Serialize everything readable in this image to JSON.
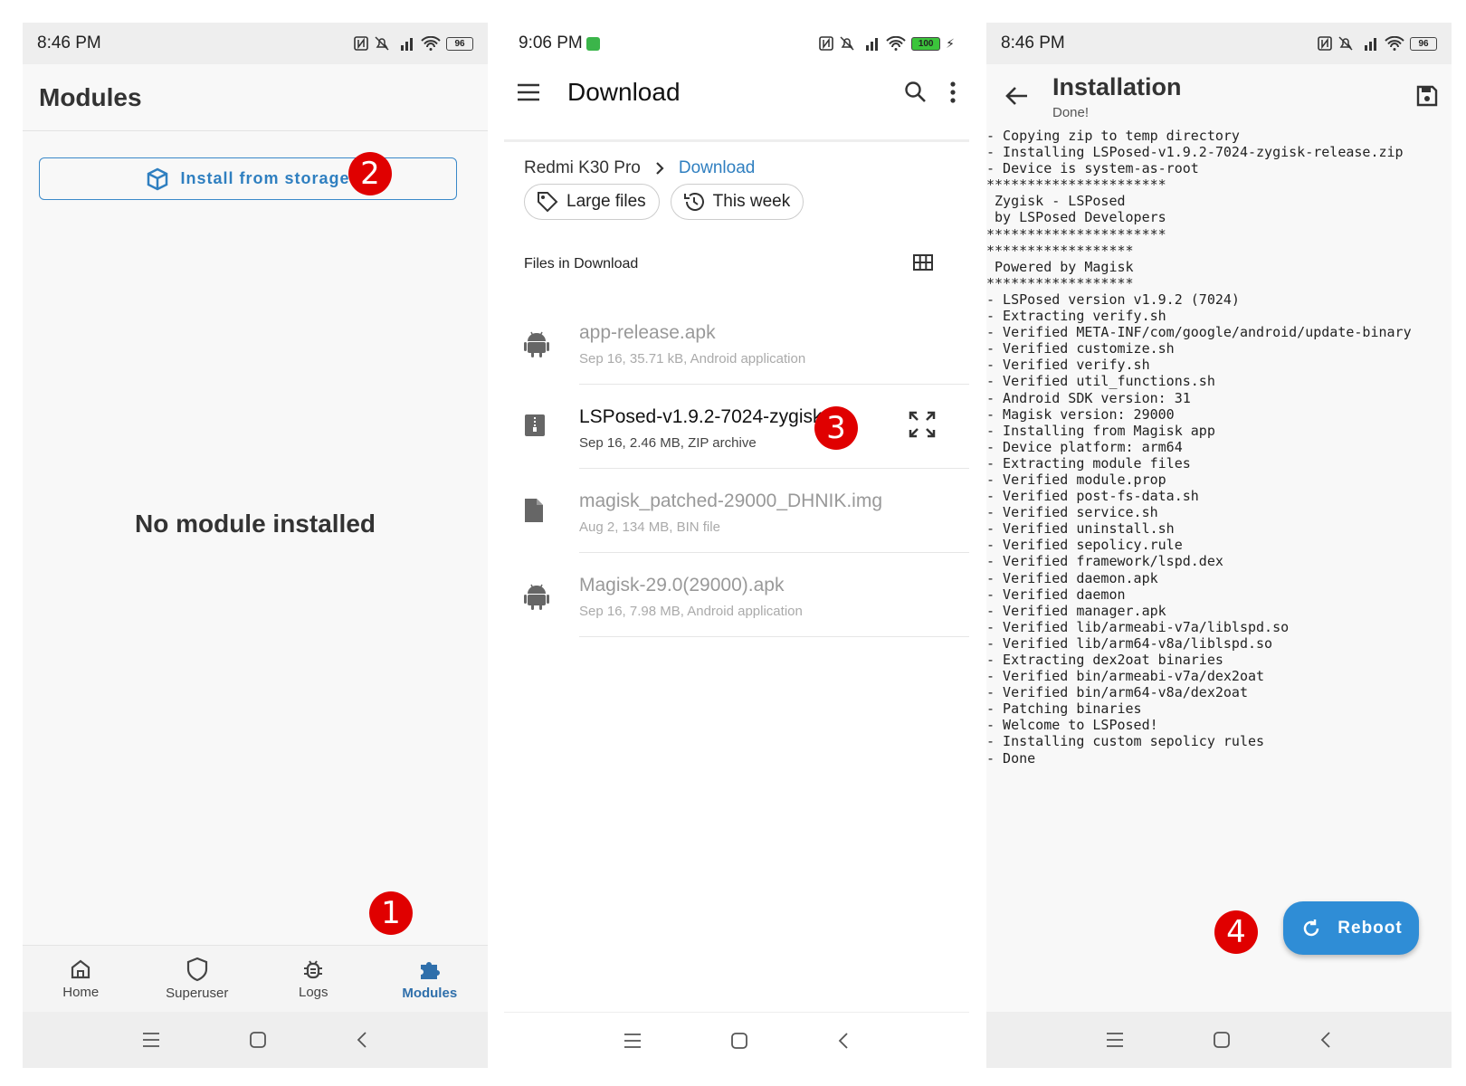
{
  "phones": [
    {
      "time": "8:46 PM",
      "battery": "96",
      "title": "Modules",
      "install_button": "Install from storage",
      "empty_text": "No module installed",
      "bottom_nav": [
        "Home",
        "Superuser",
        "Logs",
        "Modules"
      ],
      "active_tab": "Modules"
    },
    {
      "time": "9:06 PM",
      "battery": "100",
      "title": "Download",
      "breadcrumb": [
        "Redmi K30 Pro",
        "Download"
      ],
      "chips": [
        "Large files",
        "This week"
      ],
      "section_label": "Files in Download",
      "files": [
        {
          "name": "app-release.apk",
          "meta": "Sep 16, 35.71 kB, Android application",
          "icon": "android-icon"
        },
        {
          "name": "LSPosed-v1.9.2-7024-zygisk-r",
          "meta": "Sep 16, 2.46 MB, ZIP archive",
          "icon": "zip-icon"
        },
        {
          "name": "magisk_patched-29000_DHNIK.img",
          "meta": "Aug 2, 134 MB, BIN file",
          "icon": "file-icon"
        },
        {
          "name": "Magisk-29.0(29000).apk",
          "meta": "Sep 16, 7.98 MB, Android application",
          "icon": "android-icon"
        }
      ]
    },
    {
      "time": "8:46 PM",
      "battery": "96",
      "title": "Installation",
      "subtitle": "Done!",
      "reboot_label": "Reboot",
      "log": [
        "- Copying zip to temp directory",
        "- Installing LSPosed-v1.9.2-7024-zygisk-release.zip",
        "- Device is system-as-root",
        "**********************",
        " Zygisk - LSPosed",
        " by LSPosed Developers",
        "**********************",
        "******************",
        " Powered by Magisk",
        "******************",
        "- LSPosed version v1.9.2 (7024)",
        "- Extracting verify.sh",
        "- Verified META-INF/com/google/android/update-binary",
        "- Verified customize.sh",
        "- Verified verify.sh",
        "- Verified util_functions.sh",
        "- Android SDK version: 31",
        "- Magisk version: 29000",
        "- Installing from Magisk app",
        "- Device platform: arm64",
        "- Extracting module files",
        "- Verified module.prop",
        "- Verified post-fs-data.sh",
        "- Verified service.sh",
        "- Verified uninstall.sh",
        "- Verified sepolicy.rule",
        "- Verified framework/lspd.dex",
        "- Verified daemon.apk",
        "- Verified daemon",
        "- Verified manager.apk",
        "- Verified lib/armeabi-v7a/liblspd.so",
        "- Verified lib/arm64-v8a/liblspd.so",
        "- Extracting dex2oat binaries",
        "- Verified bin/armeabi-v7a/dex2oat",
        "- Verified bin/arm64-v8a/dex2oat",
        "- Patching binaries",
        "- Welcome to LSPosed!",
        "- Installing custom sepolicy rules",
        "- Done"
      ]
    }
  ],
  "step_badges": [
    "1",
    "2",
    "3",
    "4"
  ],
  "colors": {
    "accent": "#2f7fc0",
    "badge": "#e00000",
    "reboot": "#2f8dd6"
  }
}
